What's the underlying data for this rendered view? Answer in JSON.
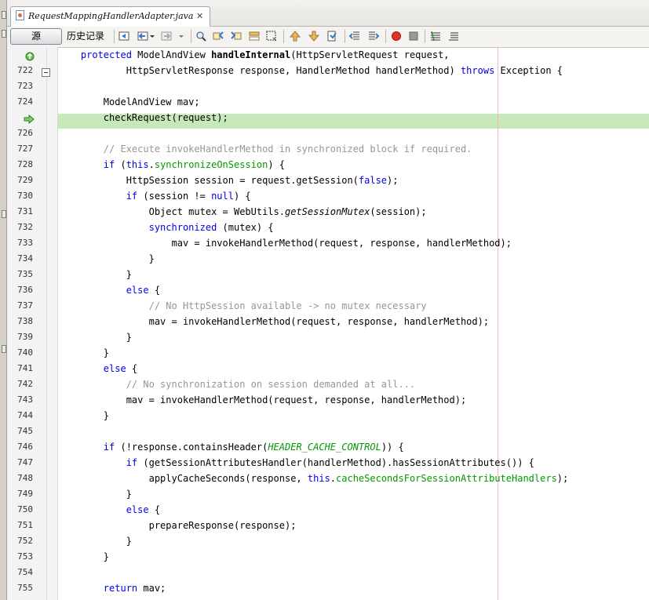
{
  "tab": {
    "title": "RequestMappingHandlerAdapter.java",
    "close": "✕"
  },
  "toolbar": {
    "source_label": "源",
    "history_label": "历史记录"
  },
  "code_lines": [
    {
      "num": "",
      "marker": "override-icon",
      "tokens": [
        [
          "    "
        ],
        [
          "protected ",
          "kw"
        ],
        [
          "ModelAndView "
        ],
        [
          "handleInternal",
          "bd"
        ],
        [
          "(HttpServletRequest request,"
        ]
      ]
    },
    {
      "num": "722",
      "marker": "fold-icon",
      "tokens": [
        [
          "            HttpServletResponse response, HandlerMethod handlerMethod) "
        ],
        [
          "throws",
          "kw"
        ],
        [
          " Exception {"
        ]
      ]
    },
    {
      "num": "723",
      "tokens": [
        [
          ""
        ]
      ]
    },
    {
      "num": "724",
      "tokens": [
        [
          "        ModelAndView mav;"
        ]
      ]
    },
    {
      "num": "",
      "marker": "current-line-arrow-icon",
      "highlight": true,
      "tokens": [
        [
          "        checkRequest(request);"
        ]
      ]
    },
    {
      "num": "726",
      "tokens": [
        [
          ""
        ]
      ]
    },
    {
      "num": "727",
      "tokens": [
        [
          "        "
        ],
        [
          "// Execute invokeHandlerMethod in synchronized block if required.",
          "cm"
        ]
      ]
    },
    {
      "num": "728",
      "tokens": [
        [
          "        "
        ],
        [
          "if",
          "kw"
        ],
        [
          " ("
        ],
        [
          "this",
          "kw"
        ],
        [
          "."
        ],
        [
          "synchronizeOnSession",
          "fd"
        ],
        [
          ") {"
        ]
      ]
    },
    {
      "num": "729",
      "tokens": [
        [
          "            HttpSession session = request.getSession("
        ],
        [
          "false",
          "kw"
        ],
        [
          ");"
        ]
      ]
    },
    {
      "num": "730",
      "tokens": [
        [
          "            "
        ],
        [
          "if",
          "kw"
        ],
        [
          " (session != "
        ],
        [
          "null",
          "kw"
        ],
        [
          ") {"
        ]
      ]
    },
    {
      "num": "731",
      "tokens": [
        [
          "                Object mutex = WebUtils."
        ],
        [
          "getSessionMutex",
          "it"
        ],
        [
          "(session);"
        ]
      ]
    },
    {
      "num": "732",
      "tokens": [
        [
          "                "
        ],
        [
          "synchronized",
          "kw"
        ],
        [
          " (mutex) {"
        ]
      ]
    },
    {
      "num": "733",
      "tokens": [
        [
          "                    mav = invokeHandlerMethod(request, response, handlerMethod);"
        ]
      ]
    },
    {
      "num": "734",
      "tokens": [
        [
          "                }"
        ]
      ]
    },
    {
      "num": "735",
      "tokens": [
        [
          "            }"
        ]
      ]
    },
    {
      "num": "736",
      "tokens": [
        [
          "            "
        ],
        [
          "else",
          "kw"
        ],
        [
          " {"
        ]
      ]
    },
    {
      "num": "737",
      "tokens": [
        [
          "                "
        ],
        [
          "// No HttpSession available -> no mutex necessary",
          "cm"
        ]
      ]
    },
    {
      "num": "738",
      "tokens": [
        [
          "                mav = invokeHandlerMethod(request, response, handlerMethod);"
        ]
      ]
    },
    {
      "num": "739",
      "tokens": [
        [
          "            }"
        ]
      ]
    },
    {
      "num": "740",
      "tokens": [
        [
          "        }"
        ]
      ]
    },
    {
      "num": "741",
      "tokens": [
        [
          "        "
        ],
        [
          "else",
          "kw"
        ],
        [
          " {"
        ]
      ]
    },
    {
      "num": "742",
      "tokens": [
        [
          "            "
        ],
        [
          "// No synchronization on session demanded at all...",
          "cm"
        ]
      ]
    },
    {
      "num": "743",
      "tokens": [
        [
          "            mav = invokeHandlerMethod(request, response, handlerMethod);"
        ]
      ]
    },
    {
      "num": "744",
      "tokens": [
        [
          "        }"
        ]
      ]
    },
    {
      "num": "745",
      "tokens": [
        [
          ""
        ]
      ]
    },
    {
      "num": "746",
      "tokens": [
        [
          "        "
        ],
        [
          "if",
          "kw"
        ],
        [
          " (!response.containsHeader("
        ],
        [
          "HEADER_CACHE_CONTROL",
          "fd it"
        ],
        [
          ")) {"
        ]
      ]
    },
    {
      "num": "747",
      "tokens": [
        [
          "            "
        ],
        [
          "if",
          "kw"
        ],
        [
          " (getSessionAttributesHandler(handlerMethod).hasSessionAttributes()) {"
        ]
      ]
    },
    {
      "num": "748",
      "tokens": [
        [
          "                applyCacheSeconds(response, "
        ],
        [
          "this",
          "kw"
        ],
        [
          "."
        ],
        [
          "cacheSecondsForSessionAttributeHandlers",
          "fd"
        ],
        [
          ");"
        ]
      ]
    },
    {
      "num": "749",
      "tokens": [
        [
          "            }"
        ]
      ]
    },
    {
      "num": "750",
      "tokens": [
        [
          "            "
        ],
        [
          "else",
          "kw"
        ],
        [
          " {"
        ]
      ]
    },
    {
      "num": "751",
      "tokens": [
        [
          "                prepareResponse(response);"
        ]
      ]
    },
    {
      "num": "752",
      "tokens": [
        [
          "            }"
        ]
      ]
    },
    {
      "num": "753",
      "tokens": [
        [
          "        }"
        ]
      ]
    },
    {
      "num": "754",
      "tokens": [
        [
          ""
        ]
      ]
    },
    {
      "num": "755",
      "tokens": [
        [
          "        "
        ],
        [
          "return",
          "kw"
        ],
        [
          " mav;"
        ]
      ]
    }
  ]
}
